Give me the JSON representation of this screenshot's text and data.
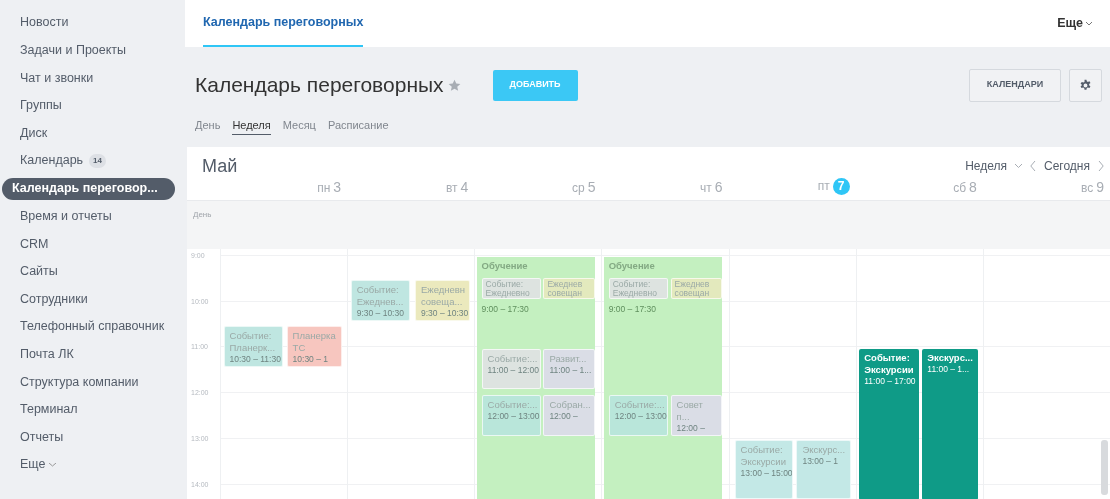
{
  "sidebar": {
    "items": [
      {
        "label": "Новости",
        "selected": false
      },
      {
        "label": "Задачи и Проекты",
        "selected": false
      },
      {
        "label": "Чат и звонки",
        "selected": false
      },
      {
        "label": "Группы",
        "selected": false
      },
      {
        "label": "Диск",
        "selected": false
      },
      {
        "label": "Календарь",
        "badge": "14",
        "selected": false
      },
      {
        "label": "Календарь переговор...",
        "selected": true
      },
      {
        "label": "Время и отчеты",
        "selected": false
      },
      {
        "label": "CRM",
        "selected": false
      },
      {
        "label": "Сайты",
        "selected": false
      },
      {
        "label": "Сотрудники",
        "selected": false
      },
      {
        "label": "Телефонный справочник",
        "selected": false
      },
      {
        "label": "Почта ЛК",
        "selected": false
      },
      {
        "label": "Структура компании",
        "selected": false
      },
      {
        "label": "Терминал",
        "selected": false
      },
      {
        "label": "Отчеты",
        "selected": false
      },
      {
        "label": "Еще",
        "kind": "more",
        "selected": false
      }
    ]
  },
  "top_bar": {
    "tabs": [
      {
        "label": "Календарь переговорных",
        "selected": true
      }
    ],
    "more": "Еще"
  },
  "header": {
    "title": "Календарь переговорных",
    "add_button": "ДОБАВИТЬ",
    "calendars_button": "КАЛЕНДАРИ"
  },
  "view_tabs": [
    {
      "label": "День",
      "selected": false
    },
    {
      "label": "Неделя",
      "selected": true
    },
    {
      "label": "Месяц",
      "selected": false
    },
    {
      "label": "Расписание",
      "selected": false
    }
  ],
  "calendar": {
    "month": "Май",
    "view_select": "Неделя",
    "today_button": "Сегодня",
    "all_day_label": "День",
    "hours": [
      "9:00",
      "10:00",
      "11:00",
      "12:00",
      "13:00",
      "14:00"
    ],
    "days": [
      {
        "weekday": "пн",
        "day": "3",
        "today": false,
        "events": [
          {
            "title": "Событие: Планерк...",
            "time": "10:30 – 11:30",
            "color": "#bfe6e1",
            "highlighted": false
          },
          {
            "title": "Планерка ТС",
            "time": "10:30 – 1",
            "color": "#f7c6bf",
            "highlighted": false
          }
        ]
      },
      {
        "weekday": "вт",
        "day": "4",
        "today": false,
        "events": [
          {
            "title": "Событие: Ежеднев...",
            "time": "9:30 – 10:30",
            "color": "#bfe6e1",
            "highlighted": false
          },
          {
            "title": "Ежедневн совеща...",
            "time": "9:30 – 10:30",
            "color": "#ebe9bd",
            "highlighted": false
          }
        ]
      },
      {
        "weekday": "ср",
        "day": "5",
        "today": false,
        "events": [
          {
            "title": "Обучение",
            "time": "9:00 – 17:30",
            "color": "#c4f0c0",
            "children": [
              {
                "title": "Событие: Ежедневно",
                "color": "#dde3e0",
                "highlighted": false
              },
              {
                "title": "Ежеднев совещан",
                "color": "#e3e9bd",
                "highlighted": false
              },
              {
                "title": "Событие:...",
                "time": "11:00 – 12:00",
                "color": "#dde3e0",
                "highlighted": false
              },
              {
                "title": "Развит...",
                "time": "11:00 – 1...",
                "color": "#dadde6",
                "highlighted": false
              },
              {
                "title": "Событие:...",
                "time": "12:00 – 13:00",
                "color": "#b9e6da",
                "highlighted": false
              },
              {
                "title": "Собран...",
                "time": "12:00 –",
                "color": "#dadde6",
                "highlighted": false
              }
            ]
          }
        ]
      },
      {
        "weekday": "чт",
        "day": "6",
        "today": false,
        "events": [
          {
            "title": "Обучение",
            "time": "9:00 – 17:30",
            "color": "#c4f0c0",
            "children": [
              {
                "title": "Событие: Ежедневно",
                "color": "#dde3e0",
                "highlighted": false
              },
              {
                "title": "Ежеднев совещан",
                "color": "#e3e9bd",
                "highlighted": false
              },
              {
                "title": "Событие:...",
                "time": "12:00 – 13:00",
                "color": "#b9e6da",
                "highlighted": false
              },
              {
                "title": "Совет п...",
                "time": "12:00 –",
                "color": "#dadde6",
                "highlighted": false
              }
            ]
          }
        ]
      },
      {
        "weekday": "пт",
        "day": "7",
        "today": true,
        "events": [
          {
            "title": "Событие: Экскурсии",
            "time": "13:00 – 15:00",
            "color": "#c3e8e6",
            "highlighted": false
          },
          {
            "title": "Экскурс...",
            "time": "13:00 – 1",
            "color": "#c3e8e6",
            "highlighted": false
          }
        ]
      },
      {
        "weekday": "сб",
        "day": "8",
        "today": false,
        "events": [
          {
            "title": "Событие: Экскурсии",
            "time": "11:00 – 17:00",
            "color": "#0f9b87",
            "highlighted": true
          },
          {
            "title": "Экскурс...",
            "time": "11:00 – 1...",
            "color": "#0f9b87",
            "highlighted": true
          }
        ]
      },
      {
        "weekday": "вс",
        "day": "9",
        "today": false
      }
    ]
  }
}
